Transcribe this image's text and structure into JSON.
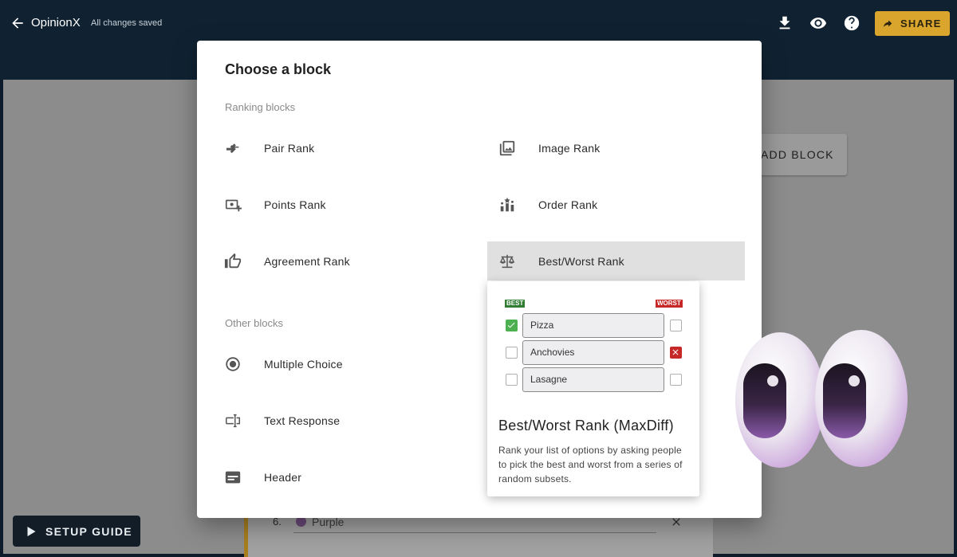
{
  "topbar": {
    "brand": "OpinionX",
    "save_status": "All changes saved",
    "share_label": "SHARE",
    "icons": [
      "back-arrow-icon",
      "download-icon",
      "eye-icon",
      "help-icon",
      "share-arrow-icon"
    ]
  },
  "background": {
    "add_block_label": "ADD BLOCK",
    "setup_guide_label": "SETUP GUIDE",
    "visible_option": {
      "number": "6.",
      "text": "Purple",
      "dot_color": "#6b4a7a"
    }
  },
  "modal": {
    "title": "Choose a block",
    "ranking_section": "Ranking blocks",
    "other_section": "Other blocks",
    "ranking_blocks": [
      {
        "label": "Pair Rank",
        "icon": "pair-arrows-icon"
      },
      {
        "label": "Image Rank",
        "icon": "image-icon"
      },
      {
        "label": "Points Rank",
        "icon": "points-money-icon"
      },
      {
        "label": "Order Rank",
        "icon": "order-bars-icon"
      },
      {
        "label": "Agreement Rank",
        "icon": "thumb-up-icon"
      },
      {
        "label": "Best/Worst Rank",
        "icon": "scale-icon",
        "selected": true
      }
    ],
    "other_blocks": [
      {
        "label": "Multiple Choice",
        "icon": "radio-icon"
      },
      {
        "label": "Text Response",
        "icon": "text-field-icon"
      },
      {
        "label": "Header",
        "icon": "header-card-icon"
      }
    ]
  },
  "preview": {
    "best_tag": "BEST",
    "worst_tag": "WORST",
    "rows": [
      {
        "option": "Pizza",
        "best": true,
        "worst": false
      },
      {
        "option": "Anchovies",
        "best": false,
        "worst": true
      },
      {
        "option": "Lasagne",
        "best": false,
        "worst": false
      }
    ],
    "title": "Best/Worst Rank (MaxDiff)",
    "description": "Rank your list of options by asking people to pick the best and worst from a series of random subsets."
  },
  "colors": {
    "topbar": "#102232",
    "share_button": "#d9a52c",
    "best_green": "#2e7d32",
    "worst_red": "#c62828",
    "mascot_purple": "#5a2d7a"
  }
}
